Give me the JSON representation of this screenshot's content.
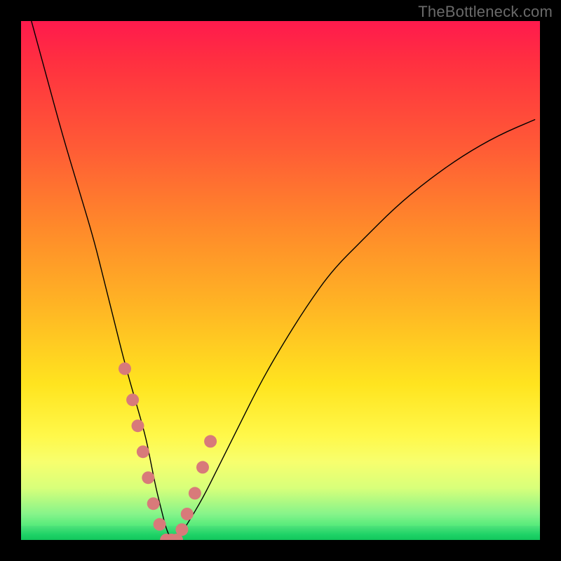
{
  "watermark": "TheBottleneck.com",
  "colors": {
    "curve": "#000000",
    "dot": "#d87a7a",
    "frame": "#000000"
  },
  "chart_data": {
    "type": "line",
    "title": "",
    "xlabel": "",
    "ylabel": "",
    "xlim": [
      0,
      100
    ],
    "ylim": [
      0,
      100
    ],
    "grid": false,
    "legend": false,
    "series": [
      {
        "name": "bottleneck-curve",
        "x": [
          2,
          5,
          8,
          11,
          14,
          16,
          18,
          20,
          22,
          24,
          25,
          26,
          27,
          28,
          29,
          30,
          32,
          35,
          38,
          42,
          46,
          50,
          55,
          60,
          66,
          72,
          78,
          85,
          92,
          99
        ],
        "y": [
          100,
          89,
          78,
          68,
          58,
          50,
          42,
          34,
          27,
          20,
          15,
          10,
          6,
          2,
          0,
          0,
          3,
          8,
          14,
          22,
          30,
          37,
          45,
          52,
          58,
          64,
          69,
          74,
          78,
          81
        ]
      }
    ],
    "highlight_points": {
      "name": "sample-dots",
      "x": [
        20,
        21.5,
        22.5,
        23.5,
        24.5,
        25.5,
        26.7,
        28,
        29,
        30,
        31,
        32,
        33.5,
        35,
        36.5
      ],
      "y": [
        33,
        27,
        22,
        17,
        12,
        7,
        3,
        0,
        0,
        0,
        2,
        5,
        9,
        14,
        19
      ]
    },
    "notes": "V-shaped bottleneck curve on a vertical rainbow gradient; minimum (0%) near x≈28–30; salmon dots cluster around the trough. Values estimated from pixels."
  }
}
